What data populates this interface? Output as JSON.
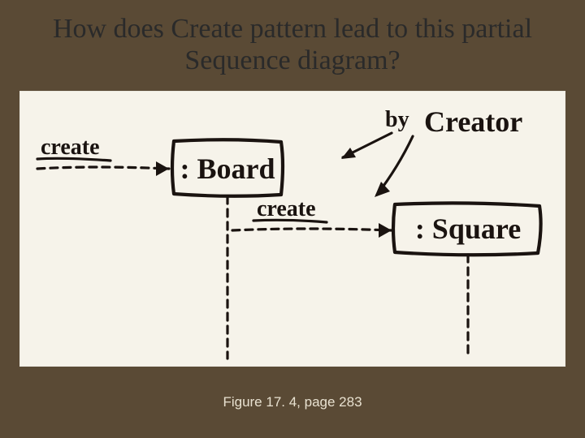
{
  "title": "How does Create pattern lead to this partial Sequence diagram?",
  "caption": "Figure 17. 4, page 283",
  "diagram": {
    "msg_create_1": "create",
    "msg_create_2": "create",
    "annotation_by": "by",
    "annotation_creator": "Creator",
    "object_board": ": Board",
    "object_square": ": Square"
  }
}
